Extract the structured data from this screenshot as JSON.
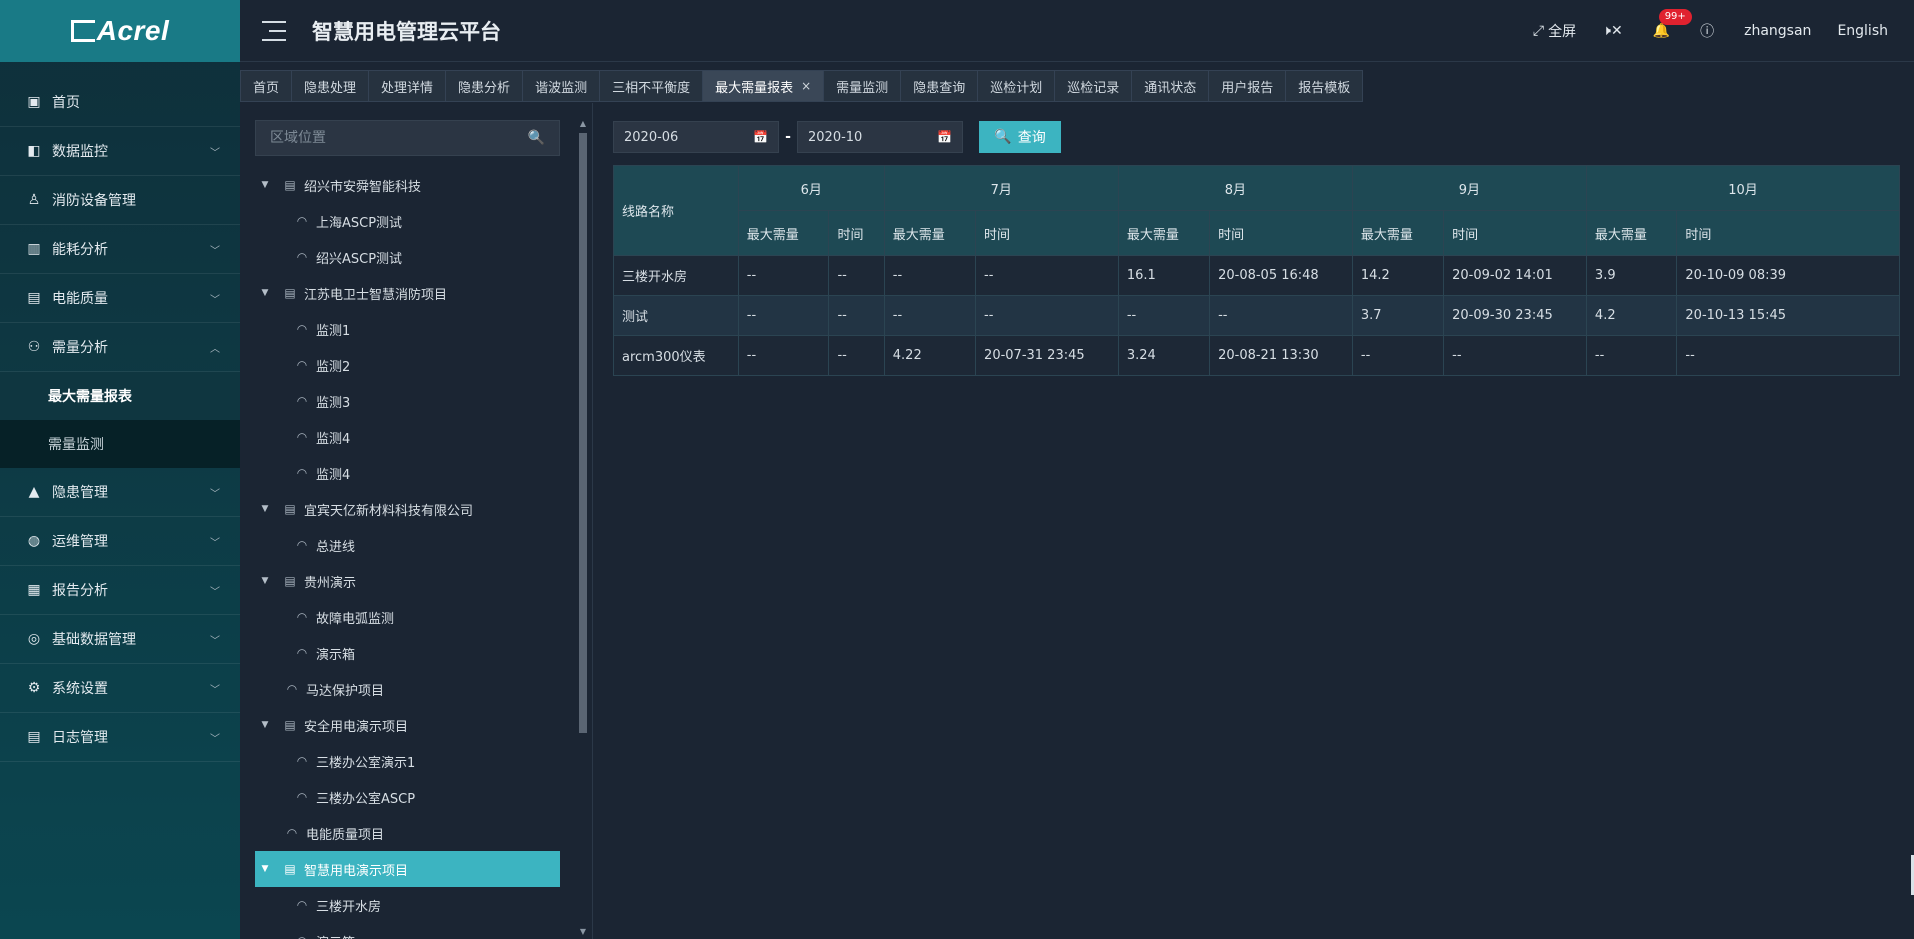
{
  "app": {
    "logo_text": "Acrel",
    "title": "智慧用电管理云平台"
  },
  "header": {
    "fullscreen": "全屏",
    "notification_count": "99+",
    "username": "zhangsan",
    "language": "English"
  },
  "sidebar": {
    "items": [
      {
        "label": "首页",
        "icon": "home-icon",
        "expandable": false
      },
      {
        "label": "数据监控",
        "icon": "monitor-icon",
        "expandable": true
      },
      {
        "label": "消防设备管理",
        "icon": "extinguisher-icon",
        "expandable": false
      },
      {
        "label": "能耗分析",
        "icon": "bar-chart-icon",
        "expandable": true
      },
      {
        "label": "电能质量",
        "icon": "calendar-icon",
        "expandable": true
      },
      {
        "label": "需量分析",
        "icon": "network-icon",
        "expandable": true,
        "expanded": true
      },
      {
        "label": "隐患管理",
        "icon": "warning-icon",
        "expandable": true
      },
      {
        "label": "运维管理",
        "icon": "globe-icon",
        "expandable": true
      },
      {
        "label": "报告分析",
        "icon": "report-icon",
        "expandable": true
      },
      {
        "label": "基础数据管理",
        "icon": "database-icon",
        "expandable": true
      },
      {
        "label": "系统设置",
        "icon": "settings-icon",
        "expandable": true
      },
      {
        "label": "日志管理",
        "icon": "log-icon",
        "expandable": true
      }
    ],
    "submenu": [
      {
        "label": "最大需量报表",
        "active": true
      },
      {
        "label": "需量监测",
        "active": false
      }
    ]
  },
  "tabs": [
    {
      "label": "首页"
    },
    {
      "label": "隐患处理"
    },
    {
      "label": "处理详情"
    },
    {
      "label": "隐患分析"
    },
    {
      "label": "谐波监测"
    },
    {
      "label": "三相不平衡度"
    },
    {
      "label": "最大需量报表",
      "active": true,
      "closable": true
    },
    {
      "label": "需量监测"
    },
    {
      "label": "隐患查询"
    },
    {
      "label": "巡检计划"
    },
    {
      "label": "巡检记录"
    },
    {
      "label": "通讯状态"
    },
    {
      "label": "用户报告"
    },
    {
      "label": "报告模板"
    }
  ],
  "tree": {
    "search_placeholder": "区域位置",
    "nodes": [
      {
        "label": "绍兴市安舜智能科技",
        "level": 0,
        "type": "group"
      },
      {
        "label": "上海ASCP测试",
        "level": 1,
        "type": "meter"
      },
      {
        "label": "绍兴ASCP测试",
        "level": 1,
        "type": "meter"
      },
      {
        "label": "江苏电卫士智慧消防项目",
        "level": 0,
        "type": "group"
      },
      {
        "label": "监测1",
        "level": 1,
        "type": "meter"
      },
      {
        "label": "监测2",
        "level": 1,
        "type": "meter"
      },
      {
        "label": "监测3",
        "level": 1,
        "type": "meter"
      },
      {
        "label": "监测4",
        "level": 1,
        "type": "meter"
      },
      {
        "label": "监测4",
        "level": 1,
        "type": "meter"
      },
      {
        "label": "宜宾天亿新材料科技有限公司",
        "level": 0,
        "type": "group"
      },
      {
        "label": "总进线",
        "level": 1,
        "type": "meter"
      },
      {
        "label": "贵州演示",
        "level": 0,
        "type": "group"
      },
      {
        "label": "故障电弧监测",
        "level": 1,
        "type": "meter"
      },
      {
        "label": "演示箱",
        "level": 1,
        "type": "meter"
      },
      {
        "label": "马达保护项目",
        "level": 0,
        "type": "leaf"
      },
      {
        "label": "安全用电演示项目",
        "level": 0,
        "type": "group"
      },
      {
        "label": "三楼办公室演示1",
        "level": 1,
        "type": "meter"
      },
      {
        "label": "三楼办公室ASCP",
        "level": 1,
        "type": "meter"
      },
      {
        "label": "电能质量项目",
        "level": 0,
        "type": "leaf"
      },
      {
        "label": "智慧用电演示项目",
        "level": 0,
        "type": "group",
        "selected": true
      },
      {
        "label": "三楼开水房",
        "level": 1,
        "type": "meter"
      },
      {
        "label": "演示箱",
        "level": 1,
        "type": "meter"
      }
    ]
  },
  "query": {
    "start": "2020-06",
    "end": "2020-10",
    "separator": "-",
    "button": "查询"
  },
  "table": {
    "line_header": "线路名称",
    "months": [
      "6月",
      "7月",
      "8月",
      "9月",
      "10月"
    ],
    "max_label": "最大需量",
    "time_label": "时间",
    "rows": [
      {
        "name": "三楼开水房",
        "cells": [
          "--",
          "--",
          "--",
          "--",
          "16.1",
          "20-08-05 16:48",
          "14.2",
          "20-09-02 14:01",
          "3.9",
          "20-10-09 08:39"
        ]
      },
      {
        "name": "测试",
        "cells": [
          "--",
          "--",
          "--",
          "--",
          "--",
          "--",
          "3.7",
          "20-09-30 23:45",
          "4.2",
          "20-10-13 15:45"
        ]
      },
      {
        "name": "arcm300仪表",
        "cells": [
          "--",
          "--",
          "4.22",
          "20-07-31 23:45",
          "3.24",
          "20-08-21 13:30",
          "--",
          "--",
          "--",
          "--"
        ]
      }
    ]
  }
}
